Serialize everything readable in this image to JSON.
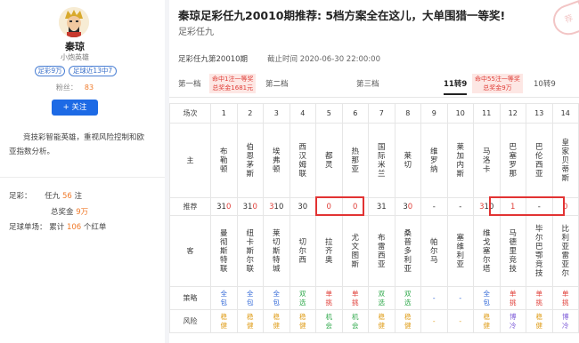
{
  "profile": {
    "name": "秦琼",
    "subtitle": "小炮英雄",
    "tags": [
      "足彩9万",
      "足球近13中7"
    ],
    "fans_label": "粉丝：",
    "fans_count": "83",
    "follow_label": "+ 关注",
    "description": "竞技彩智能英雄，重视风险控制和欧亚指数分析。",
    "stats": {
      "zucai_label": "足彩：",
      "zucai_prefix": "任九",
      "zucai_count": "56",
      "zucai_unit": "注",
      "prize_label": "总奖金",
      "prize_value": "9万",
      "single_label": "足球单场：",
      "single_prefix": "累计",
      "single_count": "106",
      "single_unit": "个红单"
    }
  },
  "article": {
    "title": "秦琼足彩任九20010期推荐: 5档方案全在这儿，大单围猎一等奖!",
    "subtitle": "足彩任九",
    "issue": "足彩任九第20010期",
    "deadline": "截止时间  2020-06-30 22:00:00"
  },
  "tabs": [
    {
      "label": "第一档"
    },
    {
      "label": "第二档"
    },
    {
      "label": "第三档"
    },
    {
      "label": "11转9"
    },
    {
      "label": "10转9"
    }
  ],
  "badges": [
    {
      "line1": "命中1注一等奖",
      "line2": "总奖金1681元"
    },
    {
      "line1": "命中55注一等奖",
      "line2": "总奖金9万"
    }
  ],
  "table": {
    "row_labels": {
      "field": "场次",
      "home": "主",
      "pick": "推荐",
      "away": "客",
      "strategy": "策略",
      "risk": "风险"
    },
    "columns": [
      {
        "no": "1",
        "home": "布勒顿",
        "away": "曼彻斯特联",
        "pick": [
          {
            "t": "3",
            "r": false
          },
          {
            "t": "1",
            "r": false
          },
          {
            "t": "0",
            "r": true
          }
        ],
        "strategy": "全包",
        "sc": "c-blue",
        "risk": "稳健",
        "rc": "c-yel"
      },
      {
        "no": "2",
        "home": "伯恩茅斯",
        "away": "纽卡斯尔联",
        "pick": [
          {
            "t": "3",
            "r": false
          },
          {
            "t": "1",
            "r": false
          },
          {
            "t": "0",
            "r": true
          }
        ],
        "strategy": "全包",
        "sc": "c-blue",
        "risk": "稳健",
        "rc": "c-yel"
      },
      {
        "no": "3",
        "home": "埃弗顿",
        "away": "莱切斯特城",
        "pick": [
          {
            "t": "3",
            "r": true
          },
          {
            "t": "1",
            "r": false
          },
          {
            "t": "0",
            "r": false
          }
        ],
        "strategy": "全包",
        "sc": "c-blue",
        "risk": "稳健",
        "rc": "c-yel"
      },
      {
        "no": "4",
        "home": "西汉姆联",
        "away": "切尔西",
        "pick": [
          {
            "t": "3",
            "r": false
          },
          {
            "t": "0",
            "r": false
          }
        ],
        "strategy": "双选",
        "sc": "c-green",
        "risk": "稳健",
        "rc": "c-yel"
      },
      {
        "no": "5",
        "home": "都灵",
        "away": "拉齐奥",
        "pick": [
          {
            "t": "0",
            "r": true
          }
        ],
        "strategy": "单挑",
        "sc": "c-red",
        "risk": "机会",
        "rc": "c-green"
      },
      {
        "no": "6",
        "home": "热那亚",
        "away": "尤文图斯",
        "pick": [
          {
            "t": "0",
            "r": true
          }
        ],
        "strategy": "单挑",
        "sc": "c-red",
        "risk": "机会",
        "rc": "c-green"
      },
      {
        "no": "7",
        "home": "国际米兰",
        "away": "布雷西亚",
        "pick": [
          {
            "t": "3",
            "r": false
          },
          {
            "t": "1",
            "r": false
          }
        ],
        "strategy": "双选",
        "sc": "c-green",
        "risk": "稳健",
        "rc": "c-yel"
      },
      {
        "no": "8",
        "home": "莱切",
        "away": "桑普多利亚",
        "pick": [
          {
            "t": "3",
            "r": false
          },
          {
            "t": "0",
            "r": true
          }
        ],
        "strategy": "双选",
        "sc": "c-green",
        "risk": "稳健",
        "rc": "c-yel"
      },
      {
        "no": "9",
        "home": "维罗纳",
        "away": "帕尔马",
        "pick": [
          {
            "t": "-",
            "r": false
          }
        ],
        "strategy": "-",
        "sc": "c-blue",
        "risk": "-",
        "rc": "c-yel"
      },
      {
        "no": "10",
        "home": "莱加内斯",
        "away": "塞维利亚",
        "pick": [
          {
            "t": "-",
            "r": false
          }
        ],
        "strategy": "-",
        "sc": "c-blue",
        "risk": "-",
        "rc": "c-yel"
      },
      {
        "no": "11",
        "home": "马洛卡",
        "away": "维戈塞尔塔",
        "pick": [
          {
            "t": "3",
            "r": true
          },
          {
            "t": "1",
            "r": false
          },
          {
            "t": "0",
            "r": false
          }
        ],
        "strategy": "全包",
        "sc": "c-blue",
        "risk": "稳健",
        "rc": "c-yel"
      },
      {
        "no": "12",
        "home": "巴塞罗那",
        "away": "马德里竞技",
        "pick": [
          {
            "t": "1",
            "r": true
          }
        ],
        "strategy": "单挑",
        "sc": "c-red",
        "risk": "博冷",
        "rc": "c-purple"
      },
      {
        "no": "13",
        "home": "巴伦西亚",
        "away": "毕尔巴鄂竞技",
        "pick": [
          {
            "t": "-",
            "r": false
          }
        ],
        "strategy": "单挑",
        "sc": "c-red",
        "risk": "稳健",
        "rc": "c-yel"
      },
      {
        "no": "14",
        "home": "皇家贝蒂斯",
        "away": "比利亚雷亚尔",
        "pick": [
          {
            "t": "0",
            "r": true
          }
        ],
        "strategy": "单挑",
        "sc": "c-red",
        "risk": "博冷",
        "rc": "c-purple"
      }
    ]
  },
  "stamp_text": "荐"
}
